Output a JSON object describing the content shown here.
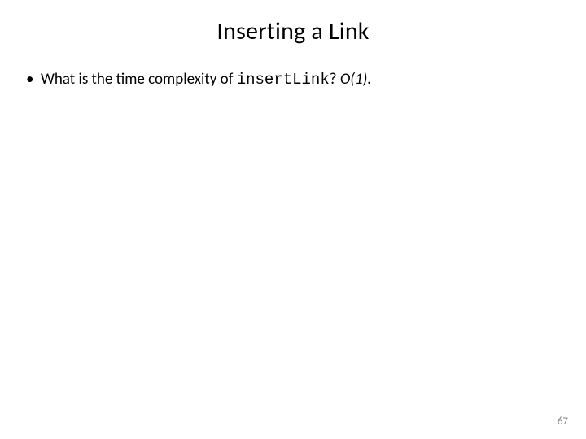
{
  "title": "Inserting a Link",
  "bullet": {
    "prefix": "What is the time complexity of ",
    "code": "insertLink",
    "question_mark": "? ",
    "answer": "O(1).",
    "answer_period": ""
  },
  "page_number": "67"
}
